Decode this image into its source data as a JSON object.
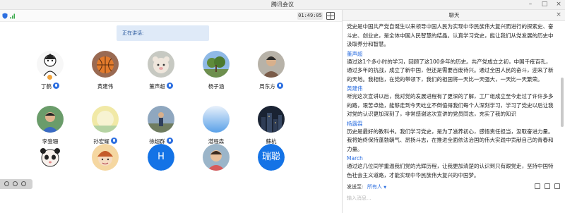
{
  "window": {
    "title": "腾讯会议"
  },
  "toolbar": {
    "timer": "01:49:05"
  },
  "banner": {
    "speaking_label": "正在讲话:"
  },
  "participants": [
    {
      "name": "丁鹤",
      "mic": true,
      "host": true,
      "avatar": "cartoon-sketch"
    },
    {
      "name": "黄建伟",
      "mic": false,
      "host": false,
      "avatar": "basketball"
    },
    {
      "name": "董声超",
      "mic": true,
      "host": false,
      "avatar": "toy-bear"
    },
    {
      "name": "杨子涵",
      "mic": false,
      "host": false,
      "avatar": "tree-sky"
    },
    {
      "name": "周东方",
      "mic": true,
      "host": false,
      "avatar": "person-photo"
    },
    {
      "name": "李登珊",
      "mic": false,
      "host": false,
      "avatar": "child-photo"
    },
    {
      "name": "孙宏耀",
      "mic": true,
      "host": false,
      "avatar": "yellow-sky"
    },
    {
      "name": "徐超群",
      "mic": true,
      "host": false,
      "avatar": "person-outdoor"
    },
    {
      "name": "湛程森",
      "mic": false,
      "host": false,
      "avatar": "blue-gradient"
    },
    {
      "name": "蘇杭",
      "mic": false,
      "host": false,
      "avatar": "dark-city"
    },
    {
      "name": "",
      "mic": false,
      "host": false,
      "avatar": "cartoon-panda"
    },
    {
      "name": "",
      "mic": false,
      "host": false,
      "avatar": "cartoon-boy"
    },
    {
      "name": "",
      "mic": false,
      "host": false,
      "avatar": "text",
      "text": "H"
    },
    {
      "name": "",
      "mic": false,
      "host": false,
      "avatar": "child-photo-2"
    },
    {
      "name": "",
      "mic": false,
      "host": false,
      "avatar": "text",
      "text": "瑞聪"
    }
  ],
  "chat": {
    "title": "聊天",
    "messages": [
      {
        "sender": "",
        "text": "党史是中国共产党自诞生以来领导中国人民为实现中华民族伟大复兴而进行的探索史、奋斗史、创业史，是全体中国人民智慧的结晶。认真学习党史，能让我们从党发展的历史中汲取养分和智慧。"
      },
      {
        "sender": "董声超",
        "text": "通过这1个多小时的学习，回顾了这100多年的历史。共产党成立之初，中国千疮百孔，通过多年的抗战，成立了新中国，但还是需要百废待兴。通过全国人民的奋斗，迎来了新的天地。我相信，在党的带领下，我们的祖国将一天比一天强大，一天比一天繁荣。"
      },
      {
        "sender": "黄建伟",
        "text": "听完这次宣讲以后，我对党的发展进程有了更深的了解，工厂组成立至今走过了许许多多的路，艰苦卓绝，能够走到今天屹立不倒值得我们每个人深刻学习，学习了党史以后让我对党的认识更加深刻了，非常感谢这次宣讲的党员同志，充实了我的知识"
      },
      {
        "sender": "杨露霖",
        "text": "历史是最好的教科书。我们学习党史，是为了滋养初心，感悟责任担当，汲取奋进力量。我将始终保持蓬勃朝气、昂扬斗志，在推进全面依法治国的伟大实践中贡献自己的青春和力量。"
      },
      {
        "sender": "March",
        "text": "通过这几位同学重温我们党的光辉历程，让我更加清楚的认识到只有跟党走，坚持中国特色社会主义道路，才能实现中华民族伟大复兴的中国梦。"
      }
    ],
    "send_label": "发送至:",
    "recipient": "所有人",
    "input_placeholder": "输入消息..."
  },
  "colors": {
    "accent": "#2d6fe0",
    "avatar_blue": "#1473e6"
  }
}
